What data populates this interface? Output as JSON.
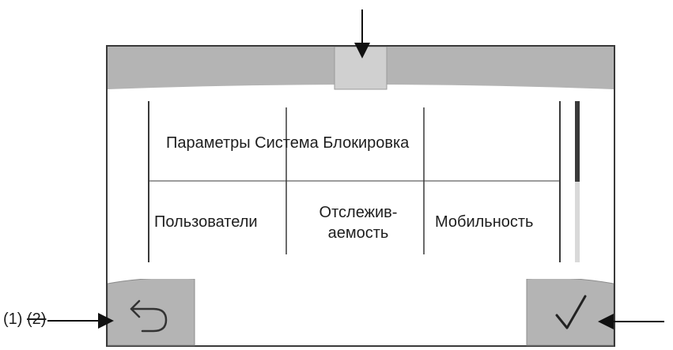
{
  "menu": {
    "row1": "Параметры Система Блокировка",
    "users": "Пользователи",
    "tracking_line1": "Отслежив-",
    "tracking_line2": "аемость",
    "mobility": "Мобильность"
  },
  "callouts": {
    "c1": "(1)",
    "c2": "(2)"
  },
  "buttons": {
    "back_icon": "undo-arrow-icon",
    "confirm_icon": "checkmark-icon"
  },
  "colors": {
    "bar_gray": "#b4b4b4",
    "tab_highlight": "#d0d0d0",
    "line": "#3a3a3a",
    "scroll_thumb": "#3a3a3a",
    "scroll_track": "#d9d9d9"
  }
}
